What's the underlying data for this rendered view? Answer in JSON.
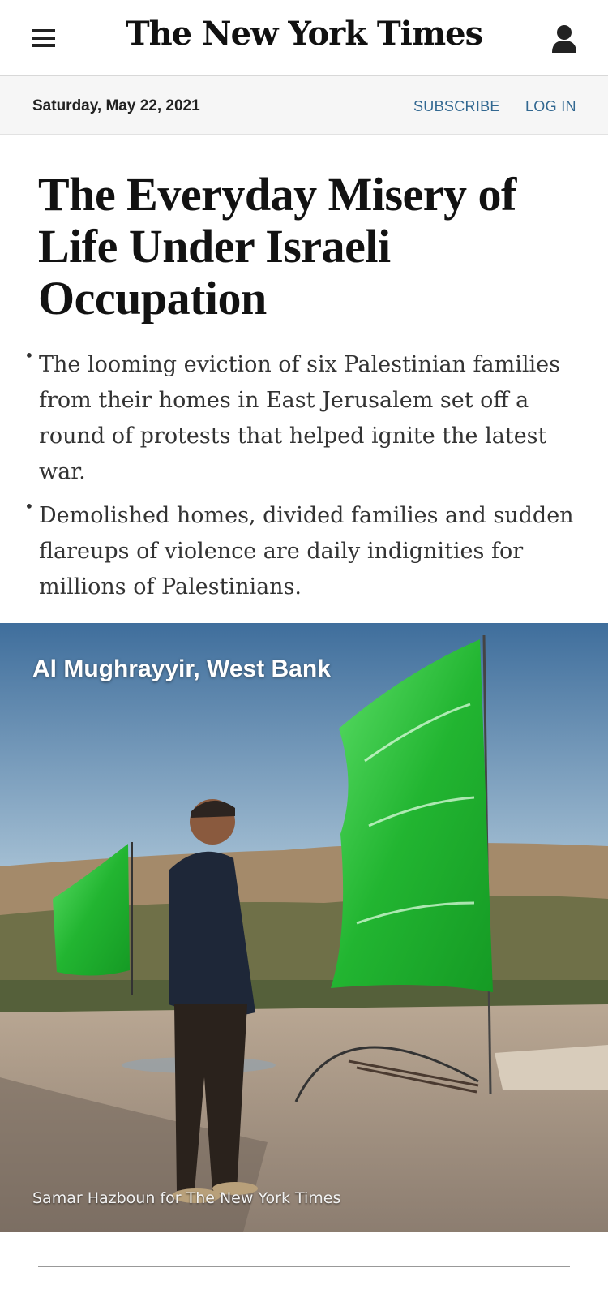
{
  "masthead": {
    "logo": "The New York Times",
    "menu_icon": "hamburger-menu-icon",
    "account_icon": "user-account-icon"
  },
  "datebar": {
    "date": "Saturday, May 22, 2021",
    "subscribe": "SUBSCRIBE",
    "login": "LOG IN"
  },
  "article": {
    "headline": "The Everyday Misery of Life Under Israeli Occupation",
    "summary": [
      "The looming eviction of six Palestinian families from their homes in East Jerusalem set off a round of protests that helped ignite the latest war.",
      "Demolished homes, divided families and sudden flareups of violence are daily indignities for millions of Palestinians."
    ],
    "photo": {
      "location": "Al Mughrayyir, West Bank",
      "credit": "Samar Hazboun for The New York Times"
    }
  },
  "colors": {
    "link_blue": "#326891",
    "headline": "#121212",
    "flag_green": "#2fbf3a"
  }
}
